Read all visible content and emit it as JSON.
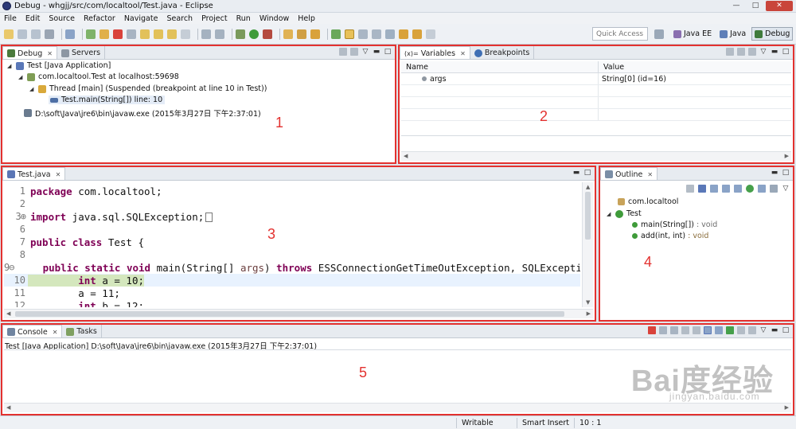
{
  "window": {
    "title": "Debug - whgjj/src/com/localtool/Test.java - Eclipse",
    "min": "—",
    "max": "□",
    "close": "✕"
  },
  "menu": [
    "File",
    "Edit",
    "Source",
    "Refactor",
    "Navigate",
    "Search",
    "Project",
    "Run",
    "Window",
    "Help"
  ],
  "quick_access": {
    "placeholder": "Quick Access"
  },
  "perspectives": [
    {
      "label": "Java EE",
      "icon": "java-ee-perspective-icon"
    },
    {
      "label": "Java",
      "icon": "java-perspective-icon"
    },
    {
      "label": "Debug",
      "icon": "debug-perspective-icon",
      "active": true
    }
  ],
  "debug_panel": {
    "tabs": [
      {
        "label": "Debug",
        "active": true
      },
      {
        "label": "Servers",
        "active": false
      }
    ],
    "tree": [
      {
        "depth": 0,
        "label": "Test [Java Application]",
        "expanded": true,
        "icon": "java-application-icon"
      },
      {
        "depth": 1,
        "label": "com.localtool.Test at localhost:59698",
        "expanded": true,
        "icon": "debug-target-icon"
      },
      {
        "depth": 2,
        "label": "Thread [main] (Suspended (breakpoint at line 10 in Test))",
        "expanded": true,
        "icon": "thread-suspended-icon"
      },
      {
        "depth": 3,
        "label": "Test.main(String[]) line: 10",
        "selected": true,
        "icon": "stack-frame-icon"
      },
      {
        "depth": 1,
        "label": "D:\\soft\\Java\\jre6\\bin\\javaw.exe (2015年3月27日 下午2:37:01)",
        "icon": "process-icon"
      }
    ],
    "region_label": "1"
  },
  "variables_panel": {
    "tabs": [
      {
        "label": "Variables",
        "prefix": "(x)=",
        "active": true
      },
      {
        "label": "Breakpoints",
        "active": false
      }
    ],
    "columns": [
      "Name",
      "Value"
    ],
    "rows": [
      {
        "name": "args",
        "value": "String[0]  (id=16)"
      }
    ],
    "region_label": "2"
  },
  "editor_panel": {
    "tab": "Test.java",
    "lines": [
      {
        "num": "1",
        "tokens": [
          {
            "t": "package",
            "k": "kw"
          },
          {
            "t": " com.localtool;",
            "k": ""
          }
        ]
      },
      {
        "num": "2",
        "tokens": []
      },
      {
        "num": "3",
        "fold": "+",
        "tokens": [
          {
            "t": "import",
            "k": "kw"
          },
          {
            "t": " java.sql.SQLException;",
            "k": ""
          }
        ]
      },
      {
        "num": "6",
        "tokens": []
      },
      {
        "num": "7",
        "tokens": [
          {
            "t": "public",
            "k": "kw"
          },
          {
            "t": " ",
            "k": ""
          },
          {
            "t": "class",
            "k": "kw"
          },
          {
            "t": " Test {",
            "k": ""
          }
        ]
      },
      {
        "num": "8",
        "tokens": []
      },
      {
        "num": "9",
        "fold": "-",
        "tokens": [
          {
            "t": "    ",
            "k": ""
          },
          {
            "t": "public",
            "k": "kw"
          },
          {
            "t": " ",
            "k": ""
          },
          {
            "t": "static",
            "k": "kw"
          },
          {
            "t": " ",
            "k": ""
          },
          {
            "t": "void",
            "k": "kw"
          },
          {
            "t": " main(String[] ",
            "k": ""
          },
          {
            "t": "args",
            "k": "par"
          },
          {
            "t": ") ",
            "k": ""
          },
          {
            "t": "throws",
            "k": "kw"
          },
          {
            "t": " ESSConnectionGetTimeOutException, SQLExcepti",
            "k": ""
          }
        ]
      },
      {
        "num": "10",
        "current": true,
        "tokens": [
          {
            "t": "        ",
            "k": ""
          },
          {
            "t": "int",
            "k": "kw"
          },
          {
            "t": " a = 10;",
            "k": ""
          }
        ]
      },
      {
        "num": "11",
        "tokens": [
          {
            "t": "        a = 11;",
            "k": ""
          }
        ]
      },
      {
        "num": "12",
        "tokens": [
          {
            "t": "        ",
            "k": ""
          },
          {
            "t": "int",
            "k": "kw"
          },
          {
            "t": " b = 12;",
            "k": ""
          }
        ]
      }
    ],
    "region_label": "3"
  },
  "outline_panel": {
    "tab": "Outline",
    "tree": [
      {
        "depth": 0,
        "label": "com.localtool",
        "icon": "package-icon"
      },
      {
        "depth": 0,
        "label": "Test",
        "expanded": true,
        "icon": "class-icon"
      },
      {
        "depth": 1,
        "label": "main(String[])",
        "detail": " : void",
        "icon": "public-static-method-icon"
      },
      {
        "depth": 1,
        "label": "add(int, int)",
        "detail": " : void",
        "icon": "public-static-method-icon"
      }
    ],
    "region_label": "4"
  },
  "console_panel": {
    "tabs": [
      {
        "label": "Console",
        "active": true
      },
      {
        "label": "Tasks",
        "active": false
      }
    ],
    "header": "Test [Java Application] D:\\soft\\Java\\jre6\\bin\\javaw.exe (2015年3月27日 下午2:37:01)",
    "region_label": "5"
  },
  "status": {
    "writable": "Writable",
    "insert_mode": "Smart Insert",
    "position": "10 : 1"
  },
  "watermark": {
    "main": "Bai度经验",
    "sub": "jingyan.baidu.com"
  },
  "colors": {
    "highlight": "#e3312f",
    "keyword": "#7f0055",
    "current_line": "#d4e7bd"
  }
}
